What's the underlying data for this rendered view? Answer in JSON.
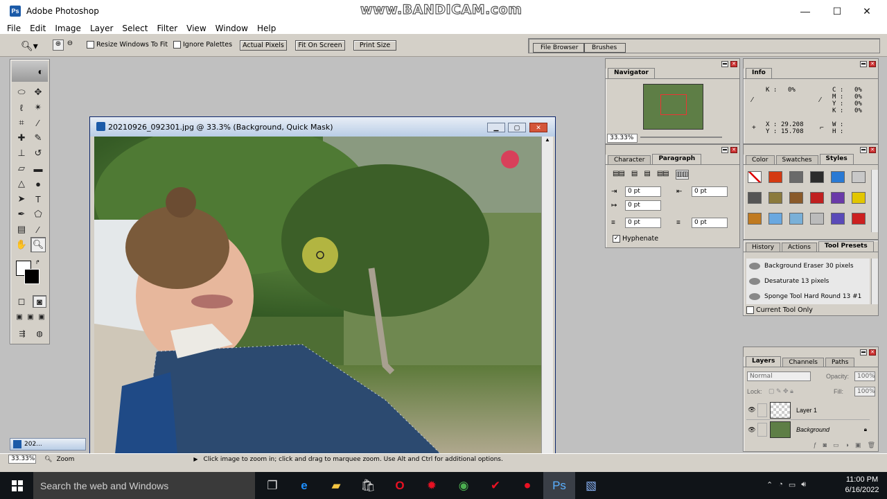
{
  "app": {
    "title": "Adobe Photoshop",
    "icon": "photoshop-logo"
  },
  "watermark": "www.BANDICAM.com",
  "window_controls": {
    "minimize": "—",
    "maximize": "☐",
    "close": "✕"
  },
  "menu": [
    "File",
    "Edit",
    "Image",
    "Layer",
    "Select",
    "Filter",
    "View",
    "Window",
    "Help"
  ],
  "options_bar": {
    "resize_windows": "Resize Windows To Fit",
    "ignore_palettes": "Ignore Palettes",
    "actual_pixels": "Actual Pixels",
    "fit_on_screen": "Fit On Screen",
    "print_size": "Print Size"
  },
  "palette_well": {
    "tabs": [
      "File Browser",
      "Brushes"
    ]
  },
  "document": {
    "title": "20210926_092301.jpg @ 33.3% (Background, Quick Mask)",
    "minimized_label": "202..."
  },
  "navigator": {
    "title": "Navigator",
    "zoom": "33.33%"
  },
  "info": {
    "title": "Info",
    "k1_label": "K :",
    "k1": "0%",
    "c_label": "C :",
    "c": "0%",
    "m_label": "M :",
    "m": "0%",
    "y_label": "Y :",
    "y": "0%",
    "k2_label": "K :",
    "k2": "0%",
    "x_label": "X :",
    "x": "29.208",
    "yy_label": "Y :",
    "yy": "15.708",
    "w_label": "W :",
    "h_label": "H :"
  },
  "paragraph_panel": {
    "tabs": [
      "Character",
      "Paragraph"
    ],
    "indent_left": "0 pt",
    "indent_right": "0 pt",
    "indent_first": "0 pt",
    "space_before": "0 pt",
    "space_after": "0 pt",
    "hyphenate": "Hyphenate"
  },
  "styles_panel": {
    "tabs": [
      "Color",
      "Swatches",
      "Styles"
    ],
    "swatch_colors": [
      "#ffffff",
      "#d43a12",
      "#6a6a6a",
      "#2c2c2c",
      "#2a7ad4",
      "#c8c8c8",
      "#555555",
      "#8b7a3c",
      "#8a5a2a",
      "#c02020",
      "#6a3aa8",
      "#e2c600",
      "#c07a20",
      "#6aa8e0",
      "#7ab0d8",
      "#bbbbbb",
      "#5a4ab8",
      "#cc2020"
    ]
  },
  "history_panel": {
    "tabs": [
      "History",
      "Actions",
      "Tool Presets"
    ],
    "items": [
      "Background Eraser 30 pixels",
      "Desaturate 13 pixels",
      "Sponge Tool Hard Round 13 #1"
    ],
    "current_only": "Current Tool Only"
  },
  "layers_panel": {
    "tabs": [
      "Layers",
      "Channels",
      "Paths"
    ],
    "blend_mode": "Normal",
    "opacity_label": "Opacity:",
    "opacity": "100%",
    "lock_label": "Lock:",
    "fill_label": "Fill:",
    "fill": "100%",
    "layers": [
      "Layer 1",
      "Background"
    ]
  },
  "status": {
    "zoom": "33.33%",
    "tool": "Zoom",
    "hint": "Click image to zoom in; click and drag to marquee zoom.  Use Alt and Ctrl for additional options."
  },
  "taskbar": {
    "search_placeholder": "Search the web and Windows",
    "time": "11:00 PM",
    "date": "6/16/2022"
  }
}
